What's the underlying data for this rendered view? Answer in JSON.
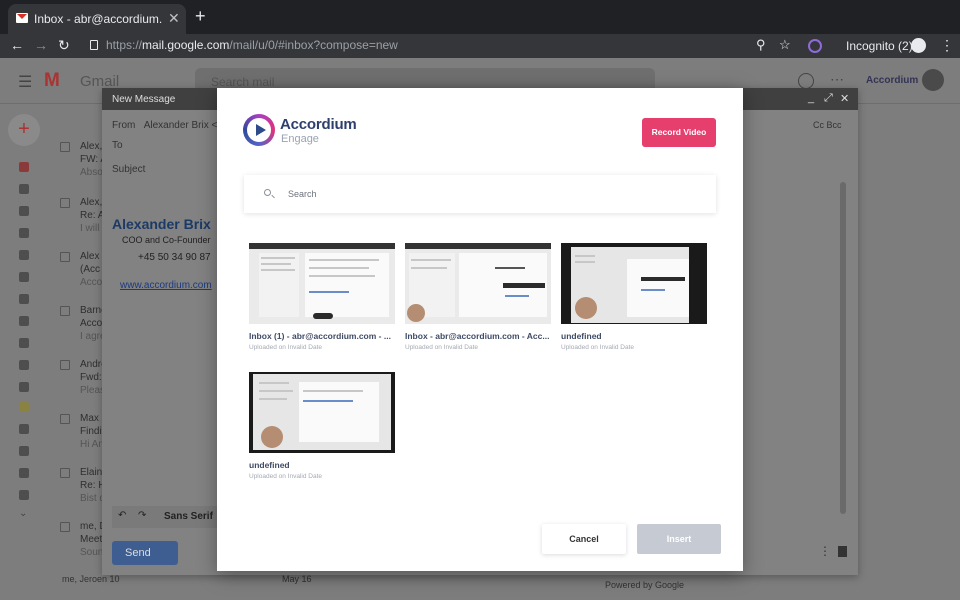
{
  "browser": {
    "tab_title": "Inbox - abr@accordium.com - ",
    "tab_close": "✕",
    "new_tab": "+",
    "url_prefix": "https://",
    "url_host": "mail.google.com",
    "url_path": "/mail/u/0/#inbox?compose=new",
    "incognito_label": "Incognito (2)"
  },
  "gmail": {
    "logo_letter": "M",
    "logo_word": "Gmail",
    "search_placeholder": "Search mail",
    "account_label": "Accordium",
    "mail_rows": [
      {
        "from": "Alex,",
        "subject": "FW: A",
        "snippet": "Abso"
      },
      {
        "from": "Alex,",
        "subject": "Re: A",
        "snippet": "I will"
      },
      {
        "from": "Alex",
        "subject": "(Acc",
        "snippet": "Acco"
      },
      {
        "from": "Barne",
        "subject": "Acco",
        "snippet": "I agre"
      },
      {
        "from": "Andre",
        "subject": "Fwd:",
        "snippet": "Pleas"
      },
      {
        "from": "Max",
        "subject": "Findi",
        "snippet": "Hi An"
      },
      {
        "from": "Elain",
        "subject": "Re: H",
        "snippet": "Bist d"
      },
      {
        "from": "me, D",
        "subject": "Meet",
        "snippet": "Soun"
      }
    ],
    "last_row_from": "me, Jeroen",
    "last_row_count": "10",
    "last_row_date": "May 16",
    "powered_by": "Powered by Google"
  },
  "compose": {
    "title": "New Message",
    "ctl_min": "_",
    "ctl_expand": "⤢",
    "ctl_close": "✕",
    "from_label": "From",
    "from_value": "Alexander Brix <ale",
    "to_label": "To",
    "subject_label": "Subject",
    "cc_bcc": "Cc Bcc",
    "signature": {
      "name": "Alexander Brix",
      "role": "COO and Co-Founder",
      "phone": "+45 50 34 90 87",
      "link": "www.accordium.com"
    },
    "font_label": "Sans Serif",
    "send_label": "Send"
  },
  "modal": {
    "brand_name": "Accordium",
    "brand_sub": "Engage",
    "record_label": "Record Video",
    "search_placeholder": "Search",
    "videos": [
      {
        "title": "Inbox (1) - abr@accordium.com - ...",
        "subtitle": "Uploaded on Invalid Date"
      },
      {
        "title": "Inbox - abr@accordium.com - Acc...",
        "subtitle": "Uploaded on Invalid Date"
      },
      {
        "title": "undefined",
        "subtitle": "Uploaded on Invalid Date"
      },
      {
        "title": "undefined",
        "subtitle": "Uploaded on Invalid Date"
      }
    ],
    "cancel_label": "Cancel",
    "insert_label": "Insert"
  },
  "colors": {
    "record_button": "#e63e6d",
    "brand_text": "#2e3f6e",
    "insert_disabled": "#c6cad2"
  }
}
